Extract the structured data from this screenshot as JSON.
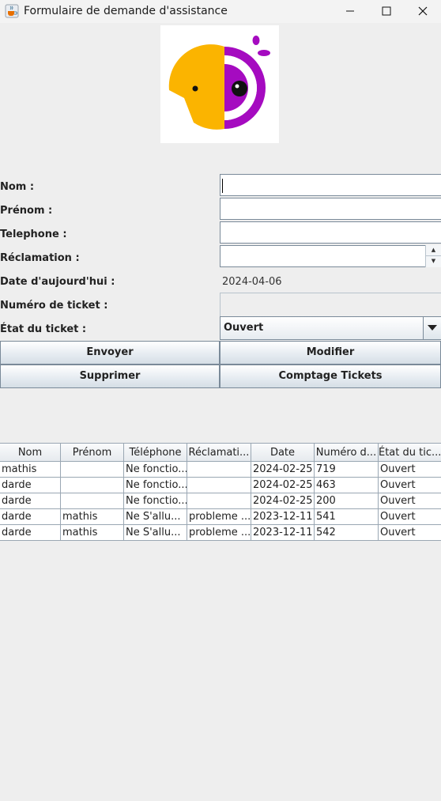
{
  "window": {
    "title": "Formulaire de demande d'assistance",
    "app_icon": "java-cup-icon",
    "controls": [
      "minimize-icon",
      "maximize-icon",
      "close-icon"
    ]
  },
  "logo": {
    "icon": "parrot-logo-icon",
    "colors": {
      "yellow": "#FBB400",
      "purple": "#A50BC0",
      "dark": "#111111"
    }
  },
  "form": {
    "nom": {
      "label": "Nom :",
      "value": ""
    },
    "prenom": {
      "label": "Prénom :",
      "value": ""
    },
    "telephone": {
      "label": "Telephone :",
      "value": ""
    },
    "reclamation": {
      "label": "Réclamation :",
      "value": ""
    },
    "date": {
      "label": "Date d'aujourd'hui :",
      "value": "2024-04-06"
    },
    "numero": {
      "label": "Numéro de ticket :",
      "value": ""
    },
    "etat": {
      "label": "État du ticket :",
      "value": "Ouvert"
    }
  },
  "buttons": {
    "envoyer": "Envoyer",
    "modifier": "Modifier",
    "supprimer": "Supprimer",
    "comptage": "Comptage Tickets"
  },
  "table": {
    "headers": [
      "Nom",
      "Prénom",
      "Téléphone",
      "Réclamati...",
      "Date",
      "Numéro d...",
      "État du tic..."
    ],
    "rows": [
      [
        "mathis",
        "",
        "Ne fonctio...",
        "",
        "2024-02-25",
        "719",
        "Ouvert"
      ],
      [
        "darde",
        "",
        "Ne fonctio...",
        "",
        "2024-02-25",
        "463",
        "Ouvert"
      ],
      [
        "darde",
        "",
        "Ne fonctio...",
        "",
        "2024-02-25",
        "200",
        "Ouvert"
      ],
      [
        "darde",
        "mathis",
        "Ne S'allu...",
        "probleme ...",
        "2023-12-11",
        "541",
        "Ouvert"
      ],
      [
        "darde",
        "mathis",
        "Ne S'allu...",
        "probleme ...",
        "2023-12-11",
        "542",
        "Ouvert"
      ]
    ]
  }
}
